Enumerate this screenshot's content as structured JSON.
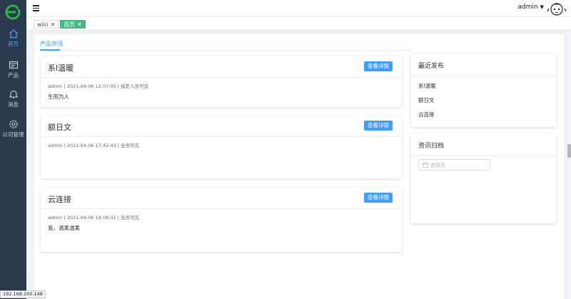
{
  "sidebar": {
    "items": [
      {
        "label": "首页",
        "icon": "home-icon",
        "active": true
      },
      {
        "label": "产品",
        "icon": "product-icon"
      },
      {
        "label": "消息",
        "icon": "bell-icon"
      },
      {
        "label": "公司管理",
        "icon": "gear-icon"
      }
    ]
  },
  "topbar": {
    "username": "admin"
  },
  "tabs": [
    {
      "label": "wiki",
      "close": "✕"
    },
    {
      "label": "首页",
      "close": "✕",
      "active": true
    }
  ],
  "inner_tab": "产品资讯",
  "cards": [
    {
      "title": "系l温暖",
      "button": "查看详情",
      "meta": "admin | 2021-04-06 12:07:05 | 指定人员可见",
      "body": "生而为人"
    },
    {
      "title": "额日文",
      "button": "查看详情",
      "meta": "admin | 2021-04-06 17:42:43 | 全员可见",
      "body": ""
    },
    {
      "title": "云连接",
      "button": "查看详情",
      "meta": "admin | 2021-04-06 18:08:31 | 全员可见",
      "body": "我，温柔温柔"
    }
  ],
  "recent": {
    "title": "最近发布",
    "items": [
      "系l温暖",
      "额日文",
      "云连接"
    ]
  },
  "archive": {
    "title": "资讯归档",
    "placeholder": "选择月"
  },
  "statusbar": "192.168.200.148",
  "colors": {
    "sidebar": "#2b3a4d",
    "primary": "#409eff",
    "tab_active": "#42b983"
  }
}
